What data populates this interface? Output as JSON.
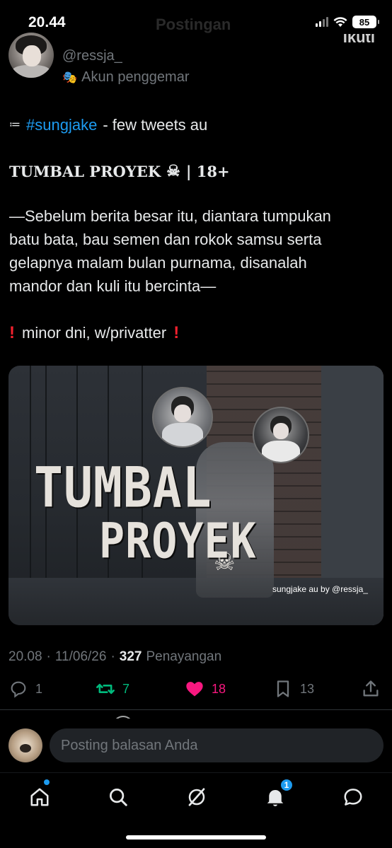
{
  "status_bar": {
    "time": "20.44",
    "battery": "85"
  },
  "background_header": {
    "title": "Postingan",
    "right_text": "Ikuti"
  },
  "author": {
    "handle": "@ressja_",
    "label": "Akun penggemar"
  },
  "tweet": {
    "hashtag": "#sungjake",
    "intro_rest": "- few tweets au",
    "title": "TUMBAL PROYEK",
    "title_suffix": "| 18+",
    "body_lines": [
      "—Sebelum berita besar itu, diantara tumpukan",
      "batu bata, bau semen dan rokok samsu serta",
      "gelapnya malam bulan purnama, disanalah",
      "mandor dan kuli itu bercinta—"
    ],
    "warning": "minor dni, w/privatter"
  },
  "media": {
    "title_line1": "TUMBAL",
    "title_line2": "PROYEK",
    "credit": "sungjake au by @ressja_"
  },
  "meta": {
    "time": "20.08",
    "date": "11/06/26",
    "views": "327",
    "views_label": "Penayangan"
  },
  "actions": {
    "replies": "1",
    "reposts": "7",
    "likes": "18",
    "bookmarks": "13"
  },
  "reply": {
    "placeholder": "Posting balasan Anda"
  },
  "tabbar": {
    "notifications_badge": "1"
  },
  "colors": {
    "accent": "#1d9bf0",
    "repost": "#00ba7c",
    "like": "#f91880",
    "warning": "#f4212e",
    "muted": "#71767b"
  },
  "icons": [
    "search-icon",
    "home-icon",
    "grok-icon",
    "bell-icon",
    "message-icon",
    "reply-icon",
    "repost-icon",
    "heart-icon",
    "bookmark-icon",
    "share-icon"
  ]
}
